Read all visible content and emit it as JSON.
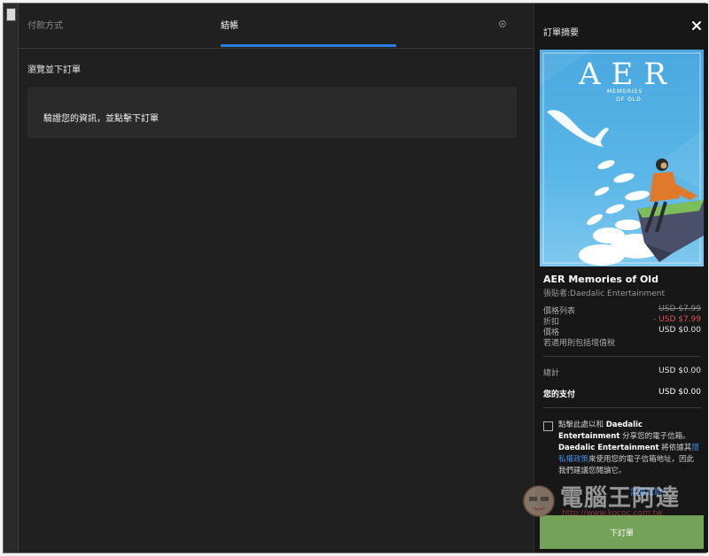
{
  "tabs": {
    "payment": "付款方式",
    "checkout": "結帳"
  },
  "main": {
    "section_title": "瀏覽並下訂單",
    "info_message": "驗證您的資訊，並點擊下訂單"
  },
  "summary": {
    "title": "訂單摘要",
    "cover": {
      "logo": "AER",
      "subtitle_line1": "MEMORIES",
      "subtitle_line2": "OF OLD"
    },
    "game_title": "AER Memories of Old",
    "publisher": "張貼者:Daedalic Entertainment",
    "price_list_label": "價格列表",
    "price_list_value": "USD $7.99",
    "discount_label": "折扣",
    "discount_value": "- USD $7.99",
    "price_label": "價格",
    "price_value": "USD $0.00",
    "vat_note": "若適用則包括增值稅",
    "subtotal_label": "總計",
    "subtotal_value": "USD $0.00",
    "pay_label": "您的支付",
    "pay_value": "USD $0.00",
    "consent": {
      "pre": "點擊此處以和",
      "company1": "Daedalic Entertainment",
      "mid1": "分享您的電子信箱。",
      "company2": "Daedalic Entertainment",
      "mid2": "將依據其",
      "link": "隱私權政策",
      "post": "來使用您的電子信箱地址，因此我們建議您閱讀它。"
    },
    "help_link": "需要幫助？",
    "place_order": "下訂單"
  },
  "watermark": {
    "text": "電腦王阿達",
    "url": "http://www.kocpc.com.tw"
  },
  "colors": {
    "accent": "#2a7de1",
    "place_order": "#74a259",
    "discount": "#d9534f"
  }
}
